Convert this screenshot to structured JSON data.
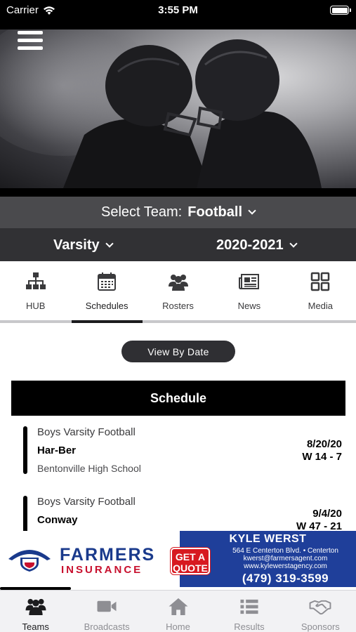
{
  "status_bar": {
    "carrier": "Carrier",
    "time": "3:55 PM"
  },
  "selectors": {
    "team_prefix": "Select Team:",
    "team": "Football",
    "level": "Varsity",
    "season": "2020-2021"
  },
  "tabs": [
    {
      "label": "HUB",
      "icon": "hierarchy-icon"
    },
    {
      "label": "Schedules",
      "icon": "calendar-icon",
      "active": true
    },
    {
      "label": "Rosters",
      "icon": "people-icon"
    },
    {
      "label": "News",
      "icon": "newspaper-icon"
    },
    {
      "label": "Media",
      "icon": "grid-icon"
    }
  ],
  "view_by_date_label": "View By Date",
  "schedule": {
    "title": "Schedule",
    "games": [
      {
        "sport": "Boys Varsity Football",
        "opponent": "Har-Ber",
        "location": "Bentonville High School",
        "date": "8/20/20",
        "result": "W 14 - 7"
      },
      {
        "sport": "Boys Varsity Football",
        "opponent": "Conway",
        "date": "9/4/20",
        "result": "W 47 - 21"
      }
    ]
  },
  "ad": {
    "brand": "FARMERS",
    "brand_sub": "INSURANCE",
    "quote_line1": "GET A",
    "quote_line2": "QUOTE",
    "agent": "KYLE WERST",
    "address": "564 E Centerton Blvd. • Centerton",
    "email": "kwerst@farmersagent.com",
    "website": "www.kylewerstagency.com",
    "phone": "(479) 319-3599",
    "colors": {
      "navy": "#1f3f9a",
      "red": "#d71920"
    }
  },
  "bottom_nav": [
    {
      "label": "Teams",
      "icon": "teams-icon",
      "active": true
    },
    {
      "label": "Broadcasts",
      "icon": "video-camera-icon"
    },
    {
      "label": "Home",
      "icon": "home-icon"
    },
    {
      "label": "Results",
      "icon": "list-icon"
    },
    {
      "label": "Sponsors",
      "icon": "handshake-icon"
    }
  ]
}
